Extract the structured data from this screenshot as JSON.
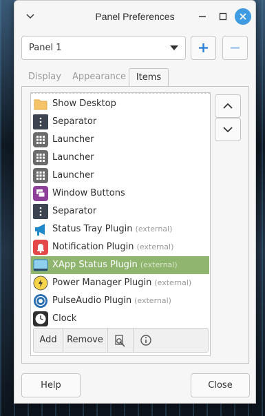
{
  "window": {
    "title": "Panel Preferences"
  },
  "panel_select": {
    "selected": "Panel 1"
  },
  "tabs": [
    {
      "label": "Display",
      "active": false
    },
    {
      "label": "Appearance",
      "active": false
    },
    {
      "label": "Items",
      "active": true
    }
  ],
  "items": [
    {
      "label": "Show Desktop",
      "ext": "",
      "icon": "folder-icon"
    },
    {
      "label": "Separator",
      "ext": "",
      "icon": "separator-icon"
    },
    {
      "label": "Launcher",
      "ext": "",
      "icon": "launcher-icon"
    },
    {
      "label": "Launcher",
      "ext": "",
      "icon": "launcher-icon"
    },
    {
      "label": "Launcher",
      "ext": "",
      "icon": "launcher-icon"
    },
    {
      "label": "Window Buttons",
      "ext": "",
      "icon": "window-buttons-icon"
    },
    {
      "label": "Separator",
      "ext": "",
      "icon": "separator-icon"
    },
    {
      "label": "Status Tray Plugin",
      "ext": "(external)",
      "icon": "megaphone-icon"
    },
    {
      "label": "Notification Plugin",
      "ext": "(external)",
      "icon": "bell-icon"
    },
    {
      "label": "XApp Status Plugin",
      "ext": "(external)",
      "icon": "xapp-status-icon",
      "selected": true
    },
    {
      "label": "Power Manager Plugin",
      "ext": "(external)",
      "icon": "power-icon"
    },
    {
      "label": "PulseAudio Plugin",
      "ext": "(external)",
      "icon": "audio-icon"
    },
    {
      "label": "Clock",
      "ext": "",
      "icon": "clock-icon"
    }
  ],
  "list_toolbar": {
    "add": "Add",
    "remove": "Remove"
  },
  "footer": {
    "help": "Help",
    "close": "Close"
  },
  "colors": {
    "accent": "#3f9ce0",
    "selection": "#8fb56f"
  }
}
